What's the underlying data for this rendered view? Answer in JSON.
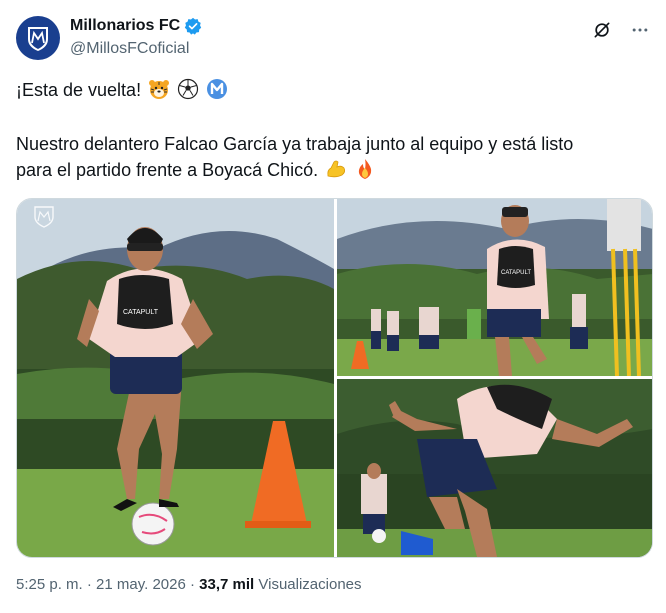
{
  "author": {
    "display_name": "Millonarios FC",
    "handle": "@MillosFCoficial",
    "verified": true
  },
  "tweet": {
    "line1": "¡Esta de vuelta!",
    "line2": "Nuestro delantero Falcao García ya trabaja junto al equipo y está listo",
    "line3": "para el partido frente a Boyacá Chicó.",
    "line1_emojis": [
      "tiger-face-emoji",
      "soccer-ball-emoji",
      "letter-m-emoji"
    ],
    "line3_emojis": [
      "flexed-biceps-emoji",
      "fire-emoji"
    ]
  },
  "media": {
    "photos": [
      {
        "name": "player-dribbling-cone-photo",
        "vest_text": "CATAPULT"
      },
      {
        "name": "player-running-teammates-photo",
        "vest_text": "CATAPULT"
      },
      {
        "name": "player-lunging-photo"
      }
    ]
  },
  "meta": {
    "time": "5:25 p. m.",
    "separator": "·",
    "date": "21 may. 2026",
    "views_count": "33,7 mil",
    "views_label": "Visualizaciones"
  },
  "colors": {
    "brand_blue": "#1a3f8f",
    "verified_blue": "#1d9bf0",
    "text_primary": "#0f1419",
    "text_secondary": "#536471"
  }
}
